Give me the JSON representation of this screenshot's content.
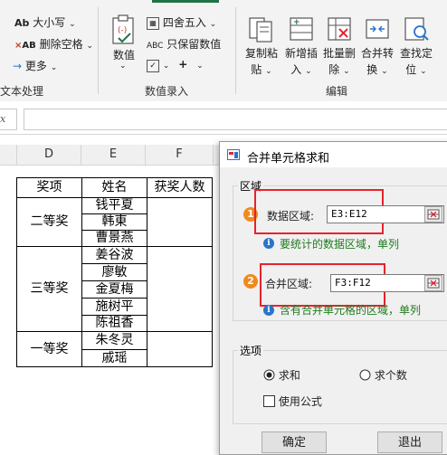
{
  "ribbon": {
    "left": {
      "change_case": "大小写",
      "remove_spaces": "删除空格",
      "more": "更多",
      "group_label": "文本处理"
    },
    "numeric": {
      "value_button": "数值",
      "round": "四舍五入",
      "keep_value": "只保留数值",
      "group_label": "数值录入"
    },
    "edit": {
      "copy_paste_l1": "复制粘",
      "copy_paste_l2": "贴",
      "insert_l1": "新增插",
      "insert_l2": "入",
      "batch_delete_l1": "批量删",
      "batch_delete_l2": "除",
      "merge_convert_l1": "合并转",
      "merge_convert_l2": "换",
      "find_locate_l1": "查找定",
      "find_locate_l2": "位",
      "group_label": "编辑"
    }
  },
  "sheet": {
    "columns": [
      "D",
      "E",
      "F"
    ],
    "headers": {
      "award": "奖项",
      "name": "姓名",
      "winners": "获奖人数"
    },
    "groups": [
      {
        "award": "二等奖",
        "names": [
          "钱平夏",
          "韩東",
          "曹景燕"
        ]
      },
      {
        "award": "三等奖",
        "names": [
          "姜谷波",
          "廖敏",
          "金夏梅",
          "施树平",
          "陈祖香"
        ]
      },
      {
        "award": "一等奖",
        "names": [
          "朱冬灵",
          "戚瑶"
        ]
      }
    ]
  },
  "dialog": {
    "title": "合并单元格求和",
    "region_legend": "区域",
    "data_range_label": "数据区域:",
    "data_range_value": "E3:E12",
    "data_range_hint": "要统计的数据区域，单列",
    "merge_range_label": "合并区域:",
    "merge_range_value": "F3:F12",
    "merge_range_hint": "含有合并单元格的区域，单列",
    "options_legend": "选项",
    "opt_sum": "求和",
    "opt_count": "求个数",
    "use_formula": "使用公式",
    "ok": "确定",
    "exit": "退出",
    "badge1": "1",
    "badge2": "2"
  },
  "colors": {
    "accent_green": "#217346",
    "highlight_red": "#e8222b",
    "badge_orange": "#f08a1c",
    "hint_green": "#1f7a1f"
  }
}
